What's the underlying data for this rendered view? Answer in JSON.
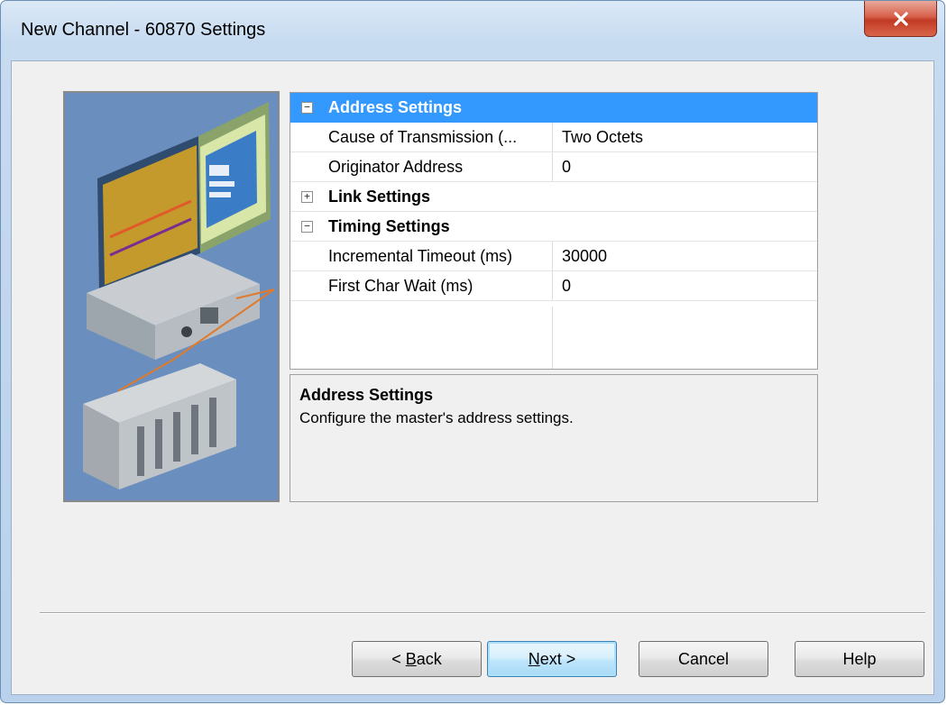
{
  "window": {
    "title": "New Channel - 60870 Settings"
  },
  "property_grid": {
    "categories": [
      {
        "name": "Address Settings",
        "expanded": true,
        "toggle": "−",
        "properties": [
          {
            "name": "Cause of Transmission (...",
            "value": "Two Octets"
          },
          {
            "name": "Originator Address",
            "value": "0"
          }
        ]
      },
      {
        "name": "Link Settings",
        "expanded": false,
        "toggle": "+"
      },
      {
        "name": "Timing Settings",
        "expanded": true,
        "toggle": "−",
        "properties": [
          {
            "name": "Incremental Timeout (ms)",
            "value": "30000"
          },
          {
            "name": "First Char Wait (ms)",
            "value": "0"
          }
        ]
      }
    ],
    "selected_category": "Address Settings"
  },
  "description": {
    "title": "Address Settings",
    "text": "Configure the master's address settings."
  },
  "buttons": {
    "back": {
      "prefix": "< ",
      "mnemonic": "B",
      "rest": "ack"
    },
    "next": {
      "mnemonic": "N",
      "rest": "ext >"
    },
    "cancel": "Cancel",
    "help": "Help"
  },
  "colors": {
    "selection": "#3399ff",
    "close_button": "#c13a24",
    "illustration_background": "#6a8fbf"
  }
}
